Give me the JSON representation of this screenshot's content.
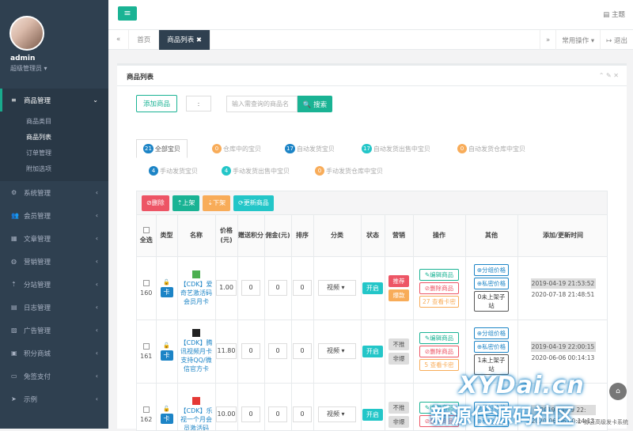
{
  "sidebar": {
    "user_name": "admin",
    "user_role": "超级管理员 ▾",
    "menu": [
      {
        "icon": "≡",
        "label": "商品管理",
        "arrow": "⌄"
      },
      {
        "icon": "⚙",
        "label": "系统管理",
        "arrow": "‹"
      },
      {
        "icon": "👥",
        "label": "会员管理",
        "arrow": "‹"
      },
      {
        "icon": "▦",
        "label": "文章管理",
        "arrow": "‹"
      },
      {
        "icon": "◍",
        "label": "营销管理",
        "arrow": "‹"
      },
      {
        "icon": "⇡",
        "label": "分站管理",
        "arrow": "‹"
      },
      {
        "icon": "▤",
        "label": "日志管理",
        "arrow": "‹"
      },
      {
        "icon": "▨",
        "label": "广告管理",
        "arrow": "‹"
      },
      {
        "icon": "▣",
        "label": "积分商城",
        "arrow": "‹"
      },
      {
        "icon": "▭",
        "label": "免签支付",
        "arrow": "‹"
      },
      {
        "icon": "➤",
        "label": "示例",
        "arrow": "‹"
      }
    ],
    "submenu": [
      "商品类目",
      "商品列表",
      "订单管理",
      "附加选项"
    ]
  },
  "topbar": {
    "menu_icon": "≡",
    "theme_label": "▤ 主题"
  },
  "tabs": {
    "left_arrow": "«",
    "items": [
      {
        "label": "首页"
      },
      {
        "label": "商品列表 ✖"
      }
    ],
    "right_arrow": "»",
    "ops": "常用操作 ▾",
    "logout": "↦ 退出"
  },
  "panel": {
    "title": "商品列表",
    "tools": "⌃ ✎ ✕",
    "add_button": "添加商品",
    "select_value": ":",
    "search_placeholder": "输入需查询的商品名",
    "search_button": "🔍 搜索"
  },
  "filters": [
    {
      "count": "21",
      "label": "全部宝贝",
      "color": "blue"
    },
    {
      "count": "0",
      "label": "仓库中的宝贝",
      "color": "or"
    },
    {
      "count": "17",
      "label": "自动发货宝贝",
      "color": "blue"
    },
    {
      "count": "17",
      "label": "自动发货出售中宝贝",
      "color": "tl"
    },
    {
      "count": "0",
      "label": "自动发货仓库中宝贝",
      "color": "or"
    },
    {
      "count": "4",
      "label": "手动发货宝贝",
      "color": "blue"
    },
    {
      "count": "4",
      "label": "手动发货出售中宝贝",
      "color": "tl"
    },
    {
      "count": "0",
      "label": "手动发货仓库中宝贝",
      "color": "or"
    }
  ],
  "actions": {
    "delete": "⊘删除",
    "up": "⇡上架",
    "down": "⇣下架",
    "refresh": "⟳更新商品"
  },
  "table": {
    "headers": [
      "全选",
      "类型",
      "名称",
      "价格(元)",
      "赠送积分",
      "佣金(元)",
      "排序",
      "分类",
      "状态",
      "营销",
      "操作",
      "其他",
      "添加/更新时间"
    ],
    "rows": [
      {
        "id": "160",
        "lock": "🔓",
        "type": "卡",
        "name": "【CDK】爱奇艺激活码会员月卡",
        "price": "1.00",
        "points": "0",
        "comm": "0",
        "sort": "0",
        "cat": "视频",
        "status": "开启",
        "mk1": "推荐",
        "mk1c": "red",
        "mk2": "爆款",
        "mk2c": "org",
        "op1": "✎编辑商品",
        "op2": "⊘删除商品",
        "op3": "27 查看卡密",
        "ot1": "⊕分组价格",
        "ot2": "⊕私密价格",
        "ot3": "0未上架子站",
        "t1": "2019-04-19 21:53:52",
        "t2": "2020-07-18 21:48:51"
      },
      {
        "id": "161",
        "lock": "🔓",
        "type": "卡",
        "name": "【CDK】腾讯视频月卡 支持QQ/微信官方卡",
        "price": "11.80",
        "points": "0",
        "comm": "0",
        "sort": "0",
        "cat": "视频",
        "status": "开启",
        "mk1": "不推",
        "mk1c": "gry",
        "mk2": "非爆",
        "mk2c": "gry",
        "op1": "✎编辑商品",
        "op2": "⊘删除商品",
        "op3": "5 查看卡密",
        "ot1": "⊕分组价格",
        "ot2": "⊕私密价格",
        "ot3": "1未上架子站",
        "t1": "2019-04-19 22:00:15",
        "t2": "2020-06-06 00:14:13"
      },
      {
        "id": "162",
        "lock": "🔓",
        "type": "卡",
        "name": "【CDK】乐视一个月会员激活码",
        "price": "10.00",
        "points": "0",
        "comm": "0",
        "sort": "0",
        "cat": "视频",
        "status": "开启",
        "mk1": "不推",
        "mk1c": "gry",
        "mk2": "非爆",
        "mk2c": "gry",
        "op1": "✎编辑商品",
        "op2": "⊘删除商品",
        "op3": "",
        "ot1": "⊕分组价格",
        "ot2": "⊕私密价格",
        "ot3": "",
        "t1": "2019-04-19 22:",
        "t2": "2020-06-06 00:14:13"
      }
    ]
  },
  "watermark": {
    "line1": "XYDai.cn",
    "line2": "新源代源码社区"
  },
  "footer": "© 鲸云高级发卡系统"
}
